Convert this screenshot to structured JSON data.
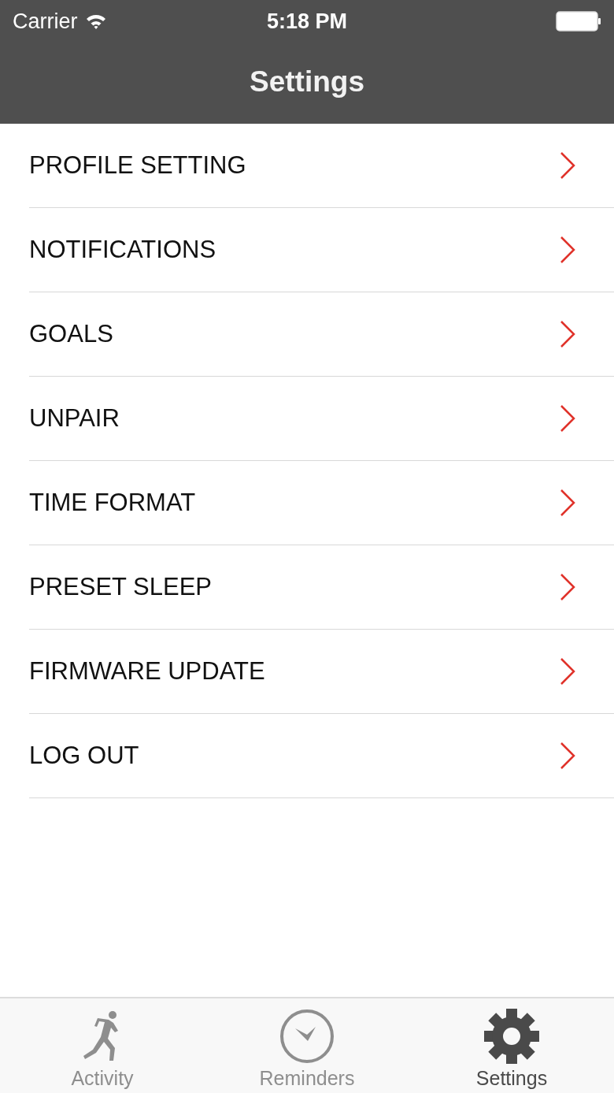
{
  "status_bar": {
    "carrier": "Carrier",
    "time": "5:18 PM"
  },
  "nav_bar": {
    "title": "Settings"
  },
  "menu_items": [
    {
      "label": "PROFILE SETTING"
    },
    {
      "label": "NOTIFICATIONS"
    },
    {
      "label": "GOALS"
    },
    {
      "label": "UNPAIR"
    },
    {
      "label": "TIME FORMAT"
    },
    {
      "label": "PRESET SLEEP"
    },
    {
      "label": "FIRMWARE UPDATE"
    },
    {
      "label": "LOG OUT"
    }
  ],
  "tab_bar": [
    {
      "label": "Activity",
      "kind": "runner",
      "selected": false
    },
    {
      "label": "Reminders",
      "kind": "clock",
      "selected": false
    },
    {
      "label": "Settings",
      "kind": "gear",
      "selected": true
    }
  ]
}
